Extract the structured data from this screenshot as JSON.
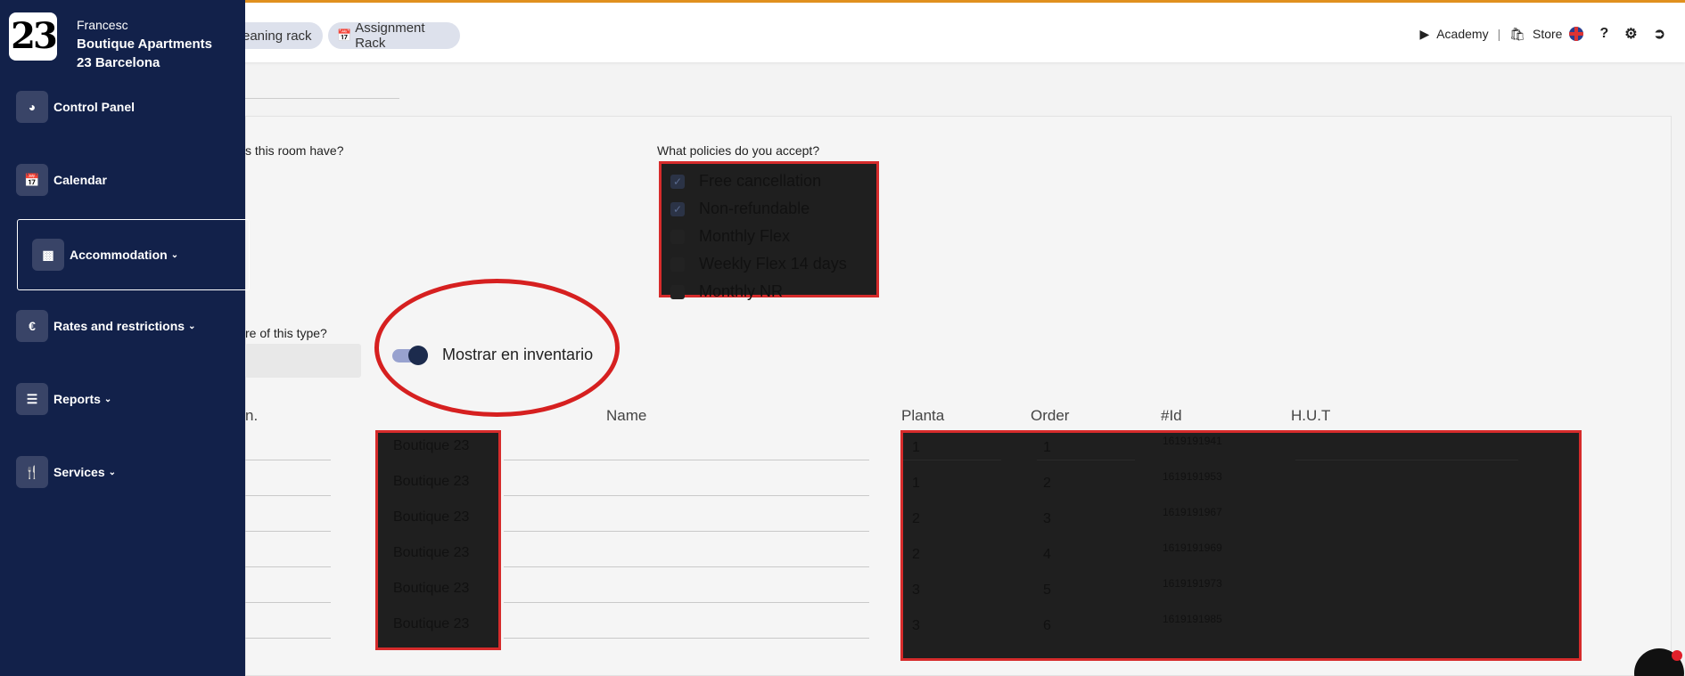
{
  "header": {
    "pill_cleaning": "eaning rack",
    "pill_assignment": "Assignment Rack",
    "academy": "Academy",
    "separator": "|",
    "store": "Store"
  },
  "sidebar": {
    "logo": "23",
    "user_name": "Francesc",
    "org_line1": "Boutique Apartments",
    "org_line2": "23 Barcelona",
    "items": [
      {
        "label": "Control Panel",
        "icon": "pie-chart-icon"
      },
      {
        "label": "Calendar",
        "icon": "calendar-icon"
      },
      {
        "label": "Accommodation",
        "icon": "building-icon",
        "active": true
      },
      {
        "label": "Rates and restrictions",
        "icon": "euro-icon"
      },
      {
        "label": "Reports",
        "icon": "list-icon"
      },
      {
        "label": "Services",
        "icon": "utensils-icon"
      }
    ]
  },
  "form": {
    "q_room_have": "s this room have?",
    "q_policies": "What policies do you accept?",
    "policies": [
      {
        "label": "Free cancellation",
        "checked": true
      },
      {
        "label": "Non-refundable",
        "checked": true
      },
      {
        "label": "Monthly Flex",
        "checked": false
      },
      {
        "label": "Weekly Flex 14 days",
        "checked": false
      },
      {
        "label": "Monthly NR",
        "checked": false
      }
    ],
    "q_type": "re of this type?",
    "toggle_label": "Mostrar en inventario"
  },
  "table": {
    "headers": {
      "n": "n.",
      "name": "Name",
      "planta": "Planta",
      "order": "Order",
      "id": "#Id",
      "hut": "H.U.T"
    },
    "rows": [
      {
        "name": "Boutique 23",
        "planta": "1",
        "order": "1",
        "id": "1619191941"
      },
      {
        "name": "Boutique 23",
        "planta": "1",
        "order": "2",
        "id": "1619191953"
      },
      {
        "name": "Boutique 23",
        "planta": "2",
        "order": "3",
        "id": "1619191967"
      },
      {
        "name": "Boutique 23",
        "planta": "2",
        "order": "4",
        "id": "1619191969"
      },
      {
        "name": "Boutique 23",
        "planta": "3",
        "order": "5",
        "id": "1619191973"
      },
      {
        "name": "Boutique 23",
        "planta": "3",
        "order": "6",
        "id": "1619191985"
      }
    ]
  }
}
